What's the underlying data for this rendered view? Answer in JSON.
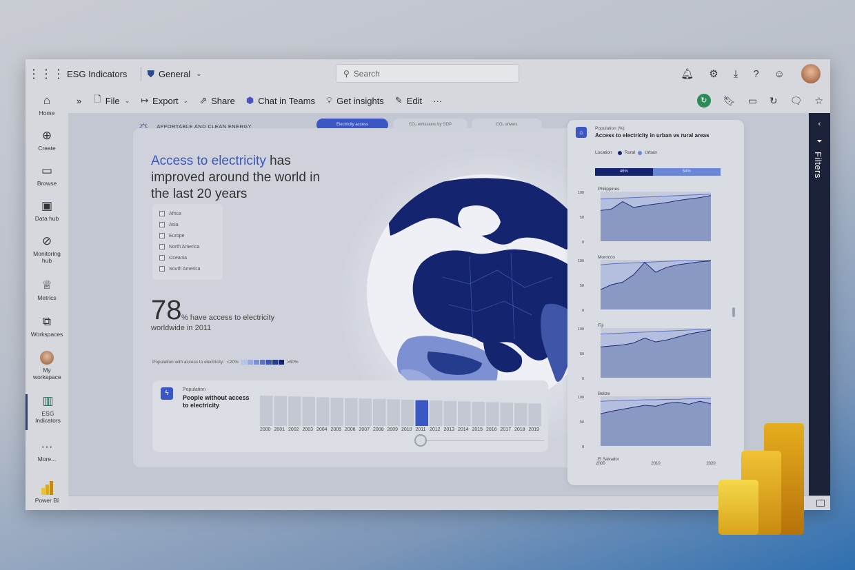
{
  "app": {
    "title": "ESG Indicators",
    "workspace": "General"
  },
  "search": {
    "placeholder": "Search"
  },
  "topbar_icons": [
    "bell-icon",
    "gear-icon",
    "download-icon",
    "help-icon",
    "feedback-icon"
  ],
  "nav": [
    {
      "label": "Home",
      "icon": "home-icon"
    },
    {
      "label": "Create",
      "icon": "plus-icon"
    },
    {
      "label": "Browse",
      "icon": "folder-icon"
    },
    {
      "label": "Data hub",
      "icon": "datahub-icon"
    },
    {
      "label": "Monitoring hub",
      "icon": "monitor-icon"
    },
    {
      "label": "Metrics",
      "icon": "trophy-icon"
    },
    {
      "label": "Workspaces",
      "icon": "workspaces-icon"
    },
    {
      "label": "My workspace",
      "icon": "avatar"
    },
    {
      "label": "ESG Indicators",
      "icon": "report-icon"
    },
    {
      "label": "More...",
      "icon": "more-icon"
    },
    {
      "label": "Power BI",
      "icon": "powerbi-icon"
    }
  ],
  "toolbar": {
    "file": "File",
    "export": "Export",
    "share": "Share",
    "chat": "Chat in Teams",
    "insights": "Get insights",
    "edit": "Edit",
    "more": "···"
  },
  "filters": {
    "label": "Filters"
  },
  "report": {
    "header": "AFFORTABLE AND CLEAN ENERGY",
    "tabs": [
      "Electricity access",
      "CO₂ emissions by GDP",
      "CO₂ drivers"
    ],
    "headline_highlight": "Access to electricity",
    "headline_rest": " has improved around the world in the last 20 years",
    "regions": [
      "Africa",
      "Asia",
      "Europe",
      "North America",
      "Oceania",
      "South America"
    ],
    "big_number": "78",
    "big_text_1": "% have access to electricity",
    "big_text_2": "worldwide in 2011",
    "legend_label": "Population with access to electricity:",
    "legend_low": "<20%",
    "legend_high": ">80%",
    "legend_colors": [
      "#b8c3e8",
      "#9aaade",
      "#7d90d2",
      "#5f74c1",
      "#3f55a8",
      "#253b8c",
      "#14246e"
    ]
  },
  "population": {
    "small": "Population",
    "title": "People without access to electricity",
    "years": [
      "2000",
      "2001",
      "2002",
      "2003",
      "2004",
      "2005",
      "2006",
      "2007",
      "2008",
      "2009",
      "2010",
      "2011",
      "2012",
      "2013",
      "2014",
      "2015",
      "2016",
      "2017",
      "2018",
      "2019"
    ],
    "selected_year": "2011"
  },
  "side_panel": {
    "small": "Population (%)",
    "title": "Access to electricity in urban vs rural areas",
    "location_label": "Location",
    "rural_label": "Rural",
    "urban_label": "Urban",
    "rural_pct": "46%",
    "urban_pct": "54%",
    "x_ticks": [
      "2000",
      "2010",
      "2020"
    ],
    "y_ticks": [
      "100",
      "50",
      "0"
    ],
    "partial_label": "El Salvador"
  },
  "chart_data": {
    "type": "area",
    "title": "Access to electricity in urban vs rural areas",
    "x": [
      2000,
      2002,
      2004,
      2006,
      2008,
      2010,
      2012,
      2014,
      2016,
      2018,
      2020
    ],
    "ylim": [
      0,
      100
    ],
    "panels": [
      {
        "name": "Philippines",
        "urban": [
          85,
          86,
          87,
          88,
          89,
          90,
          91,
          92,
          93,
          94,
          95
        ],
        "rural": [
          62,
          65,
          80,
          68,
          72,
          75,
          78,
          82,
          85,
          88,
          92
        ]
      },
      {
        "name": "Morocco",
        "urban": [
          90,
          92,
          93,
          94,
          95,
          96,
          97,
          98,
          98,
          99,
          99
        ],
        "rural": [
          40,
          50,
          55,
          70,
          95,
          75,
          85,
          90,
          93,
          96,
          98
        ]
      },
      {
        "name": "Fiji",
        "urban": [
          88,
          89,
          90,
          91,
          92,
          93,
          94,
          95,
          96,
          97,
          98
        ],
        "rural": [
          62,
          64,
          66,
          70,
          80,
          72,
          76,
          82,
          88,
          92,
          96
        ]
      },
      {
        "name": "Belize",
        "urban": [
          90,
          91,
          92,
          92,
          93,
          93,
          94,
          94,
          95,
          95,
          96
        ],
        "rural": [
          65,
          70,
          74,
          78,
          82,
          80,
          86,
          88,
          84,
          90,
          85
        ]
      }
    ]
  }
}
